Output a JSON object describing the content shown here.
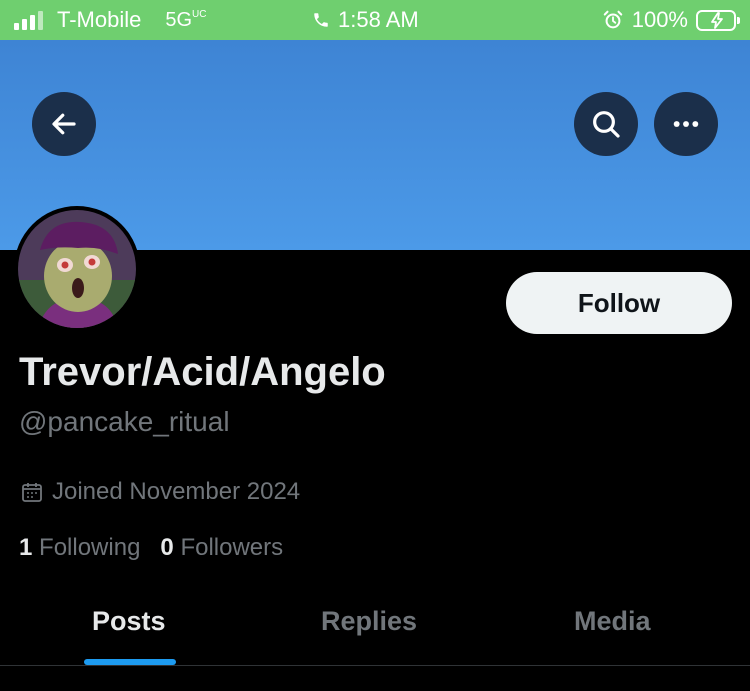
{
  "status_bar": {
    "carrier": "T-Mobile",
    "network": "5G",
    "network_sub": "UC",
    "time": "1:58 AM",
    "battery": "100%"
  },
  "header": {
    "back_icon": "arrow-left-icon",
    "search_icon": "search-icon",
    "more_icon": "ellipsis-icon",
    "banner_color": "#4a94e2"
  },
  "profile": {
    "display_name": "Trevor/Acid/Angelo",
    "handle": "@pancake_ritual",
    "joined": "Joined November 2024",
    "following_count": "1",
    "following_label": "Following",
    "followers_count": "0",
    "followers_label": "Followers",
    "follow_button": "Follow"
  },
  "tabs": [
    {
      "label": "Posts",
      "active": true
    },
    {
      "label": "Replies",
      "active": false
    },
    {
      "label": "Media",
      "active": false
    }
  ],
  "colors": {
    "accent": "#1d9bf0",
    "status_bar": "#6fcf6f",
    "background": "#000000"
  }
}
